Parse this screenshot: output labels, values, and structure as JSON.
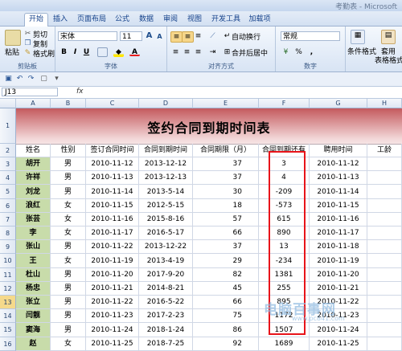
{
  "window": {
    "title": "考勤表 - Microsoft"
  },
  "tabs": [
    "开始",
    "插入",
    "页面布局",
    "公式",
    "数据",
    "审阅",
    "视图",
    "开发工具",
    "加载项"
  ],
  "ribbon": {
    "clipboard": {
      "paste": "粘贴",
      "cut": "剪切",
      "copy": "复制",
      "format_painter": "格式刷",
      "label": "剪贴板"
    },
    "font": {
      "name": "宋体",
      "size": "11",
      "label": "字体",
      "bold": "B",
      "italic": "I",
      "underline": "U",
      "font_color": "A",
      "grow": "A",
      "shrink": "A"
    },
    "alignment": {
      "wrap": "自动换行",
      "merge": "合并后居中",
      "label": "对齐方式"
    },
    "number": {
      "format": "常规",
      "percent": "%",
      "comma": ",",
      "label": "数字"
    },
    "styles": {
      "conditional": "条件格式",
      "table": "套用",
      "table2": "表格格式"
    }
  },
  "formula_bar": {
    "name_box": "J13",
    "fx": "fx"
  },
  "columns": [
    "A",
    "B",
    "C",
    "D",
    "E",
    "F",
    "G",
    "H"
  ],
  "sheet_title": "签约合同到期时间表",
  "headers": [
    "姓名",
    "性别",
    "签订合同时间",
    "合同到期时间",
    "合同期限（月）",
    "合同到期还有",
    "聘用时间",
    "工龄"
  ],
  "rows": [
    {
      "num": "3",
      "name": "胡开",
      "gender": "男",
      "sign": "2010-11-12",
      "expire": "2013-12-12",
      "term": "37",
      "left": "3",
      "hire": "2010-11-12"
    },
    {
      "num": "4",
      "name": "许祥",
      "gender": "男",
      "sign": "2010-11-13",
      "expire": "2013-12-13",
      "term": "37",
      "left": "4",
      "hire": "2010-11-13"
    },
    {
      "num": "5",
      "name": "刘龙",
      "gender": "男",
      "sign": "2010-11-14",
      "expire": "2013-5-14",
      "term": "30",
      "left": "-209",
      "hire": "2010-11-14"
    },
    {
      "num": "6",
      "name": "浪红",
      "gender": "女",
      "sign": "2010-11-15",
      "expire": "2012-5-15",
      "term": "18",
      "left": "-573",
      "hire": "2010-11-15"
    },
    {
      "num": "7",
      "name": "张芸",
      "gender": "女",
      "sign": "2010-11-16",
      "expire": "2015-8-16",
      "term": "57",
      "left": "615",
      "hire": "2010-11-16"
    },
    {
      "num": "8",
      "name": "李",
      "gender": "女",
      "sign": "2010-11-17",
      "expire": "2016-5-17",
      "term": "66",
      "left": "890",
      "hire": "2010-11-17"
    },
    {
      "num": "9",
      "name": "张山",
      "gender": "男",
      "sign": "2010-11-22",
      "expire": "2013-12-22",
      "term": "37",
      "left": "13",
      "hire": "2010-11-18"
    },
    {
      "num": "10",
      "name": "王",
      "gender": "女",
      "sign": "2010-11-19",
      "expire": "2013-4-19",
      "term": "29",
      "left": "-234",
      "hire": "2010-11-19"
    },
    {
      "num": "11",
      "name": "杜山",
      "gender": "男",
      "sign": "2010-11-20",
      "expire": "2017-9-20",
      "term": "82",
      "left": "1381",
      "hire": "2010-11-20"
    },
    {
      "num": "12",
      "name": "杨忠",
      "gender": "男",
      "sign": "2010-11-21",
      "expire": "2014-8-21",
      "term": "45",
      "left": "255",
      "hire": "2010-11-21"
    },
    {
      "num": "13",
      "name": "张立",
      "gender": "男",
      "sign": "2010-11-22",
      "expire": "2016-5-22",
      "term": "66",
      "left": "895",
      "hire": "2010-11-22"
    },
    {
      "num": "14",
      "name": "闫靓",
      "gender": "男",
      "sign": "2010-11-23",
      "expire": "2017-2-23",
      "term": "75",
      "left": "1172",
      "hire": "2010-11-23"
    },
    {
      "num": "15",
      "name": "窦海",
      "gender": "男",
      "sign": "2010-11-24",
      "expire": "2018-1-24",
      "term": "86",
      "left": "1507",
      "hire": "2010-11-24"
    },
    {
      "num": "16",
      "name": "赵",
      "gender": "女",
      "sign": "2010-11-25",
      "expire": "2018-7-25",
      "term": "92",
      "left": "1689",
      "hire": "2010-11-25"
    }
  ],
  "row_labels": [
    "1",
    "2"
  ],
  "watermark": {
    "main": "电脑百事网",
    "sub": "www.pc841.com"
  }
}
